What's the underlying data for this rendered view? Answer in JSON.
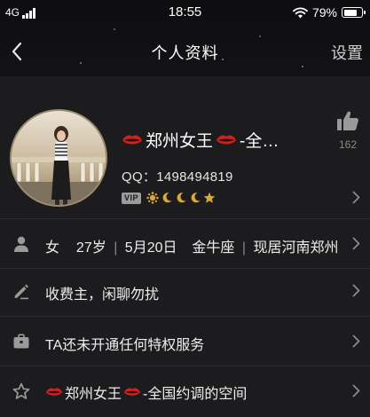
{
  "status_bar": {
    "carrier": "4G",
    "time": "18:55",
    "battery_percent": "79%",
    "battery_level": 0.79
  },
  "nav": {
    "back_icon": "chevron-left-icon",
    "title": "个人资料",
    "settings_label": "设置"
  },
  "profile": {
    "name": "郑州女王",
    "name_suffix": "-全…",
    "qq": "QQ：1498494819",
    "vip_label": "VIP",
    "level_icons": [
      "sun-icon",
      "moon-icon",
      "moon-icon",
      "moon-icon",
      "star-icon"
    ],
    "like_count": "162"
  },
  "info_rows": {
    "gender": "女",
    "age": "27岁",
    "birthday": "5月20日",
    "zodiac": "金牛座",
    "location": "现居河南郑州",
    "signature": "收费主，闲聊勿扰",
    "privilege": "TA还未开通任何特权服务",
    "space_name": "郑州女王",
    "space_suffix": "-全国约调的空间"
  },
  "colors": {
    "background": "#1c1c1e",
    "header": "#0d0d0f",
    "lips_red": "#d0211c",
    "level_gold": "#d8a83a",
    "icon_gray": "#9a9a9a"
  }
}
